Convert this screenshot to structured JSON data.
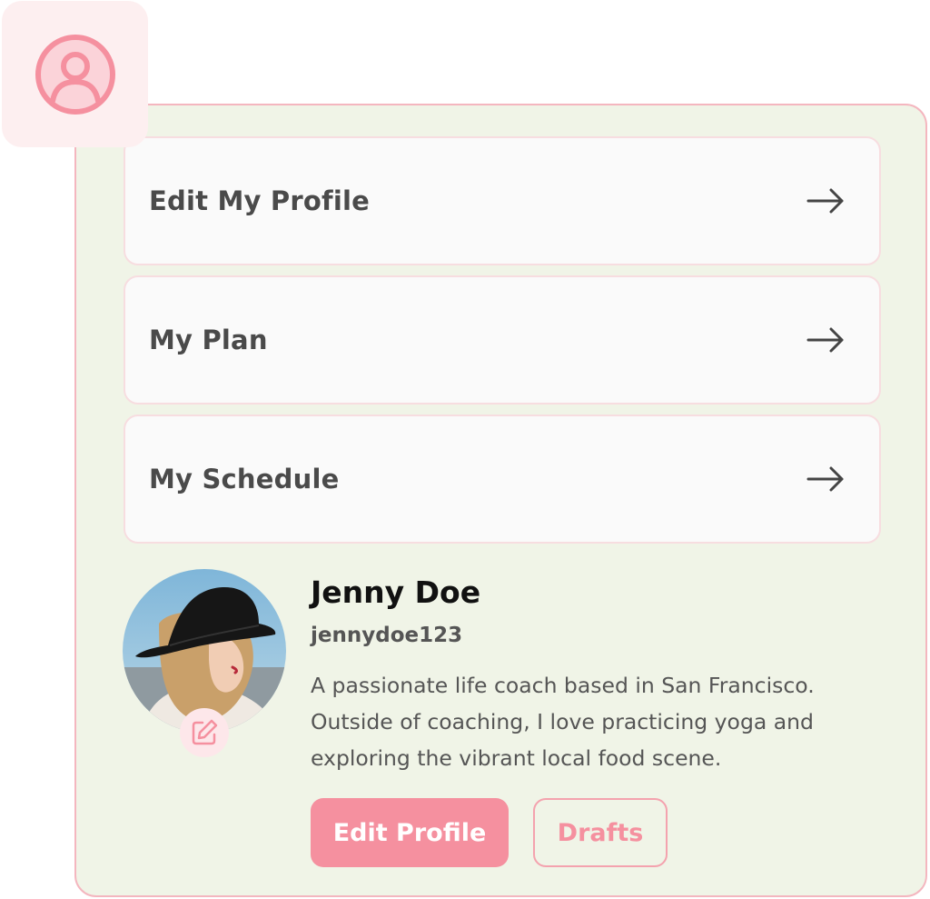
{
  "colors": {
    "accent": "#f5909f",
    "panel_bg": "#f0f4e7",
    "panel_border": "#f4b6bf",
    "icon_tile_bg": "#fdeff0",
    "menu_bg": "#fafafa"
  },
  "icons": {
    "header": "user-circle-icon",
    "menu_arrow": "arrow-right-icon",
    "avatar_edit": "edit-pencil-icon"
  },
  "menu": {
    "items": [
      {
        "label": "Edit My Profile"
      },
      {
        "label": "My Plan"
      },
      {
        "label": "My Schedule"
      }
    ]
  },
  "profile": {
    "name": "Jenny Doe",
    "username": "jennydoe123",
    "bio": "A passionate life coach based in San Francisco. Outside of coaching, I  love practicing yoga and exploring the vibrant local food scene.",
    "edit_button": "Edit Profile",
    "drafts_button": "Drafts"
  }
}
